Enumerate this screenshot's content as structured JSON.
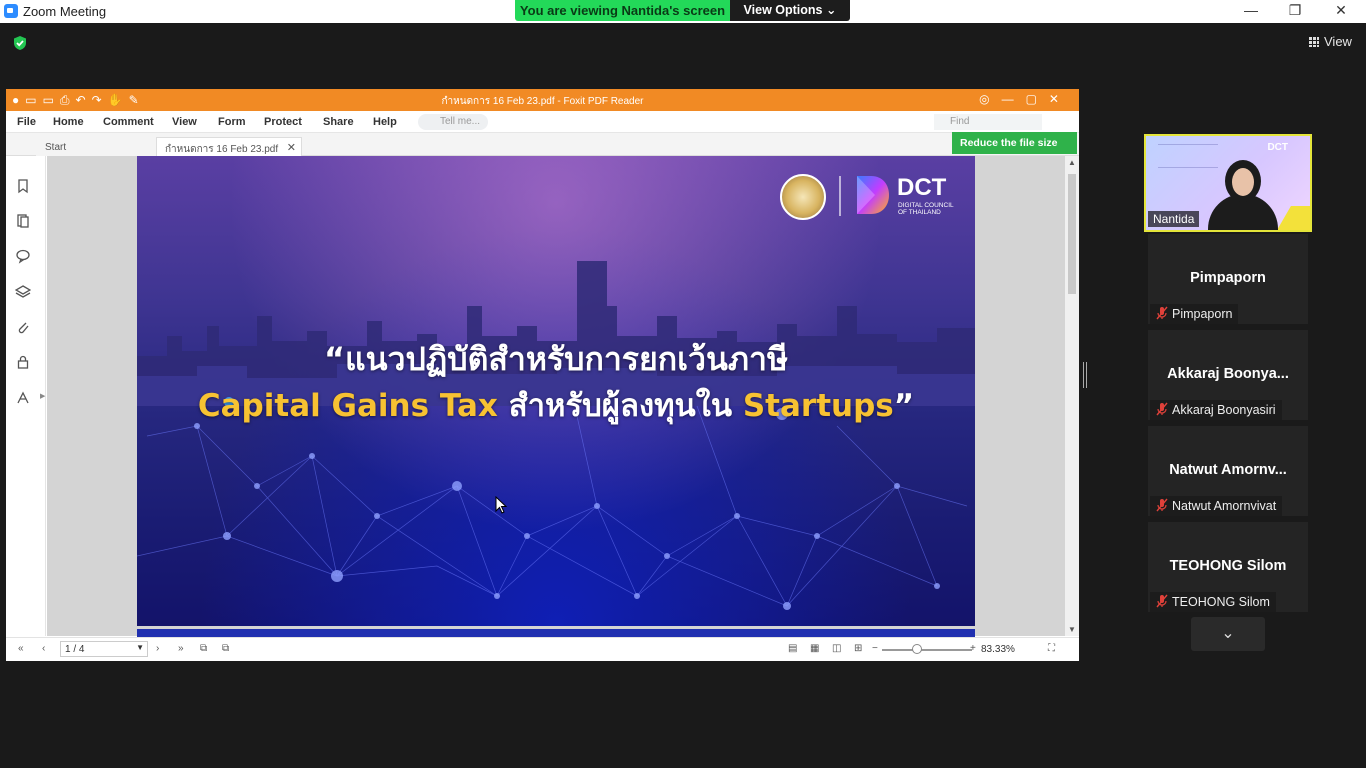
{
  "zoom": {
    "title": "Zoom Meeting",
    "banner": "You are viewing Nantida's screen",
    "view_options": "View Options",
    "view_label": "View",
    "minimize": "—",
    "restore": "❐",
    "close": "✕"
  },
  "foxit": {
    "title": "กำหนดการ 16 Feb 23.pdf - Foxit PDF Reader",
    "menu": [
      "File",
      "Home",
      "Comment",
      "View",
      "Form",
      "Protect",
      "Share",
      "Help"
    ],
    "tell_me_placeholder": "Tell me...",
    "find_placeholder": "Find",
    "tabs": [
      "Start",
      "กำหนดการ 16 Feb 23.pdf"
    ],
    "reduce_button": "Reduce the file size",
    "page_indicator": "1 / 4",
    "zoom_level": "83.33%"
  },
  "slide": {
    "line1": "“แนวปฏิบัติสำหรับการยกเว้นภาษี",
    "line2_gold_a": "Capital Gains Tax",
    "line2_white": " สำหรับผู้ลงทุนใน ",
    "line2_gold_b": "Startups",
    "line2_end": "”",
    "logo_text": "DCT",
    "logo_sub": "DIGITAL COUNCIL OF THAILAND"
  },
  "participants": {
    "video": {
      "name": "Nantida",
      "logo": "DCT"
    },
    "tiles": [
      {
        "display": "Pimpaporn",
        "footer": "Pimpaporn"
      },
      {
        "display": "Akkaraj  Boonya...",
        "footer": "Akkaraj Boonyasiri"
      },
      {
        "display": "Natwut  Amornv...",
        "footer": "Natwut Amornvivat"
      },
      {
        "display": "TEOHONG Silom",
        "footer": "TEOHONG Silom"
      }
    ],
    "more": "⌄"
  },
  "colors": {
    "banner_green": "#23d959",
    "foxit_orange": "#f18a24",
    "reduce_green": "#2fb24a",
    "gold_text": "#f7c232",
    "active_speaker_border": "#e4e53a",
    "mute_red": "#e0413a"
  }
}
